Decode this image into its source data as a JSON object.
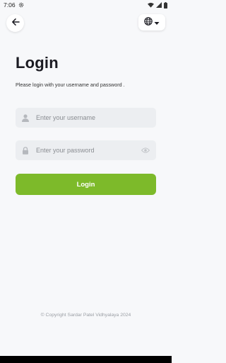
{
  "status_bar": {
    "time": "7:06",
    "icons": [
      "settings-gear-icon",
      "wifi-icon",
      "signal-icon",
      "battery-icon"
    ]
  },
  "header": {
    "back_icon": "arrow-left-icon",
    "language_icon": "globe-icon",
    "language_dropdown_icon": "caret-down-icon"
  },
  "main": {
    "title": "Login",
    "subtitle": "Please login with your username and password .",
    "username_placeholder": "Enter your username",
    "username_value": "",
    "password_placeholder": "Enter your password",
    "password_value": "",
    "login_label": "Login"
  },
  "footer": {
    "copyright": "© Copyright Sardar Patel Vidhyalaya 2024"
  },
  "colors": {
    "background": "#f7f8fa",
    "accent": "#7dba2a",
    "field_bg": "#eceef1"
  }
}
